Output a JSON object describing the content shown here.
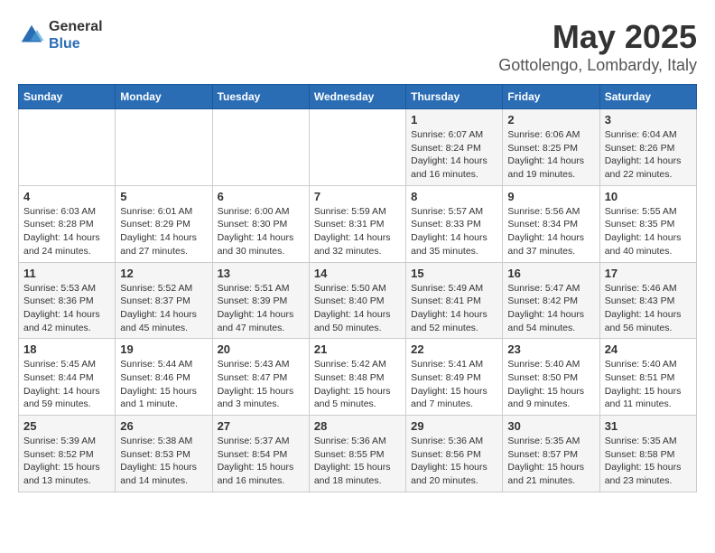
{
  "logo": {
    "general": "General",
    "blue": "Blue"
  },
  "title": "May 2025",
  "subtitle": "Gottolengo, Lombardy, Italy",
  "days_of_week": [
    "Sunday",
    "Monday",
    "Tuesday",
    "Wednesday",
    "Thursday",
    "Friday",
    "Saturday"
  ],
  "weeks": [
    [
      {
        "day": "",
        "info": ""
      },
      {
        "day": "",
        "info": ""
      },
      {
        "day": "",
        "info": ""
      },
      {
        "day": "",
        "info": ""
      },
      {
        "day": "1",
        "info": "Sunrise: 6:07 AM\nSunset: 8:24 PM\nDaylight: 14 hours\nand 16 minutes."
      },
      {
        "day": "2",
        "info": "Sunrise: 6:06 AM\nSunset: 8:25 PM\nDaylight: 14 hours\nand 19 minutes."
      },
      {
        "day": "3",
        "info": "Sunrise: 6:04 AM\nSunset: 8:26 PM\nDaylight: 14 hours\nand 22 minutes."
      }
    ],
    [
      {
        "day": "4",
        "info": "Sunrise: 6:03 AM\nSunset: 8:28 PM\nDaylight: 14 hours\nand 24 minutes."
      },
      {
        "day": "5",
        "info": "Sunrise: 6:01 AM\nSunset: 8:29 PM\nDaylight: 14 hours\nand 27 minutes."
      },
      {
        "day": "6",
        "info": "Sunrise: 6:00 AM\nSunset: 8:30 PM\nDaylight: 14 hours\nand 30 minutes."
      },
      {
        "day": "7",
        "info": "Sunrise: 5:59 AM\nSunset: 8:31 PM\nDaylight: 14 hours\nand 32 minutes."
      },
      {
        "day": "8",
        "info": "Sunrise: 5:57 AM\nSunset: 8:33 PM\nDaylight: 14 hours\nand 35 minutes."
      },
      {
        "day": "9",
        "info": "Sunrise: 5:56 AM\nSunset: 8:34 PM\nDaylight: 14 hours\nand 37 minutes."
      },
      {
        "day": "10",
        "info": "Sunrise: 5:55 AM\nSunset: 8:35 PM\nDaylight: 14 hours\nand 40 minutes."
      }
    ],
    [
      {
        "day": "11",
        "info": "Sunrise: 5:53 AM\nSunset: 8:36 PM\nDaylight: 14 hours\nand 42 minutes."
      },
      {
        "day": "12",
        "info": "Sunrise: 5:52 AM\nSunset: 8:37 PM\nDaylight: 14 hours\nand 45 minutes."
      },
      {
        "day": "13",
        "info": "Sunrise: 5:51 AM\nSunset: 8:39 PM\nDaylight: 14 hours\nand 47 minutes."
      },
      {
        "day": "14",
        "info": "Sunrise: 5:50 AM\nSunset: 8:40 PM\nDaylight: 14 hours\nand 50 minutes."
      },
      {
        "day": "15",
        "info": "Sunrise: 5:49 AM\nSunset: 8:41 PM\nDaylight: 14 hours\nand 52 minutes."
      },
      {
        "day": "16",
        "info": "Sunrise: 5:47 AM\nSunset: 8:42 PM\nDaylight: 14 hours\nand 54 minutes."
      },
      {
        "day": "17",
        "info": "Sunrise: 5:46 AM\nSunset: 8:43 PM\nDaylight: 14 hours\nand 56 minutes."
      }
    ],
    [
      {
        "day": "18",
        "info": "Sunrise: 5:45 AM\nSunset: 8:44 PM\nDaylight: 14 hours\nand 59 minutes."
      },
      {
        "day": "19",
        "info": "Sunrise: 5:44 AM\nSunset: 8:46 PM\nDaylight: 15 hours\nand 1 minute."
      },
      {
        "day": "20",
        "info": "Sunrise: 5:43 AM\nSunset: 8:47 PM\nDaylight: 15 hours\nand 3 minutes."
      },
      {
        "day": "21",
        "info": "Sunrise: 5:42 AM\nSunset: 8:48 PM\nDaylight: 15 hours\nand 5 minutes."
      },
      {
        "day": "22",
        "info": "Sunrise: 5:41 AM\nSunset: 8:49 PM\nDaylight: 15 hours\nand 7 minutes."
      },
      {
        "day": "23",
        "info": "Sunrise: 5:40 AM\nSunset: 8:50 PM\nDaylight: 15 hours\nand 9 minutes."
      },
      {
        "day": "24",
        "info": "Sunrise: 5:40 AM\nSunset: 8:51 PM\nDaylight: 15 hours\nand 11 minutes."
      }
    ],
    [
      {
        "day": "25",
        "info": "Sunrise: 5:39 AM\nSunset: 8:52 PM\nDaylight: 15 hours\nand 13 minutes."
      },
      {
        "day": "26",
        "info": "Sunrise: 5:38 AM\nSunset: 8:53 PM\nDaylight: 15 hours\nand 14 minutes."
      },
      {
        "day": "27",
        "info": "Sunrise: 5:37 AM\nSunset: 8:54 PM\nDaylight: 15 hours\nand 16 minutes."
      },
      {
        "day": "28",
        "info": "Sunrise: 5:36 AM\nSunset: 8:55 PM\nDaylight: 15 hours\nand 18 minutes."
      },
      {
        "day": "29",
        "info": "Sunrise: 5:36 AM\nSunset: 8:56 PM\nDaylight: 15 hours\nand 20 minutes."
      },
      {
        "day": "30",
        "info": "Sunrise: 5:35 AM\nSunset: 8:57 PM\nDaylight: 15 hours\nand 21 minutes."
      },
      {
        "day": "31",
        "info": "Sunrise: 5:35 AM\nSunset: 8:58 PM\nDaylight: 15 hours\nand 23 minutes."
      }
    ]
  ]
}
